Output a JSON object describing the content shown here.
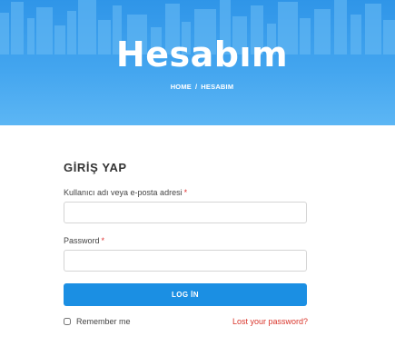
{
  "hero": {
    "title": "Hesabım",
    "breadcrumb": {
      "home": "HOME",
      "separator": "/",
      "current": "HESABIM"
    }
  },
  "login_form": {
    "title": "GİRİŞ YAP",
    "username_label": "Kullanıcı adı veya e-posta adresi",
    "password_label": "Password",
    "required_mark": "*",
    "username_value": "",
    "password_value": "",
    "submit_label": "LOG İN",
    "remember_label": "Remember me",
    "remember_checked": false,
    "lost_password_link": "Lost your password?"
  },
  "colors": {
    "hero_top": "#2f95e8",
    "hero_bottom": "#5cb6f4",
    "button": "#1b8fe3",
    "required": "#e03030",
    "link": "#d9352b"
  }
}
